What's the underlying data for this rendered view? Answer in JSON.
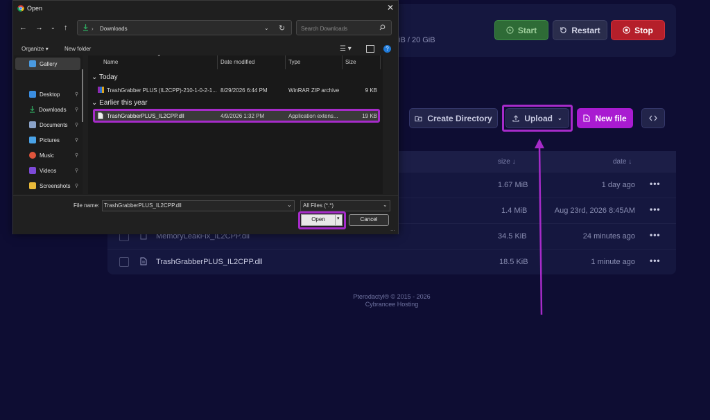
{
  "panel": {
    "disk_usage": "iB / 20 GiB",
    "buttons": {
      "start": "Start",
      "restart": "Restart",
      "stop": "Stop"
    },
    "toolbar": {
      "create_directory": "Create Directory",
      "upload": "Upload",
      "new_file": "New file"
    },
    "columns": {
      "size": "size",
      "date": "date"
    },
    "files": [
      {
        "name": "",
        "size": "1.67 MiB",
        "date": "1 day ago"
      },
      {
        "name": "",
        "size": "1.4 MiB",
        "date": "Aug 23rd, 2026 8:45AM"
      },
      {
        "name": "MemoryLeakFix_IL2CPP.dll",
        "size": "34.5 KiB",
        "date": "24 minutes ago"
      },
      {
        "name": "TrashGrabberPLUS_IL2CPP.dll",
        "size": "18.5 KiB",
        "date": "1 minute ago"
      }
    ],
    "footer": {
      "line1": "Pterodactyl® © 2015 - 2026",
      "line2": "Cybrancee Hosting"
    }
  },
  "dialog": {
    "title": "Open",
    "address": "Downloads",
    "search_placeholder": "Search Downloads",
    "toolbar": {
      "organize": "Organize",
      "new_folder": "New folder"
    },
    "nav": [
      {
        "label": "Gallery",
        "icon": "gallery-icon"
      },
      {
        "label": "Desktop",
        "icon": "desktop-icon"
      },
      {
        "label": "Downloads",
        "icon": "download-icon"
      },
      {
        "label": "Documents",
        "icon": "documents-icon"
      },
      {
        "label": "Pictures",
        "icon": "pictures-icon"
      },
      {
        "label": "Music",
        "icon": "music-icon"
      },
      {
        "label": "Videos",
        "icon": "videos-icon"
      },
      {
        "label": "Screenshots",
        "icon": "folder-icon"
      }
    ],
    "columns": {
      "name": "Name",
      "modified": "Date modified",
      "type": "Type",
      "size": "Size"
    },
    "groups": [
      {
        "label": "Today",
        "files": [
          {
            "name": "TrashGrabber PLUS (IL2CPP)-210-1-0-2-1...",
            "modified": "8/29/2026 6:44 PM",
            "type": "WinRAR ZIP archive",
            "size": "9 KB"
          }
        ]
      },
      {
        "label": "Earlier this year",
        "files": [
          {
            "name": "TrashGrabberPLUS_IL2CPP.dll",
            "modified": "4/9/2026 1:32 PM",
            "type": "Application extens...",
            "size": "19 KB"
          }
        ]
      }
    ],
    "file_name_label": "File name:",
    "file_name_value": "TrashGrabberPLUS_IL2CPP.dll",
    "filter": "All Files (*.*)",
    "open_label": "Open",
    "cancel_label": "Cancel"
  },
  "colors": {
    "accent": "#a62bc9",
    "background": "#0e0d33"
  }
}
